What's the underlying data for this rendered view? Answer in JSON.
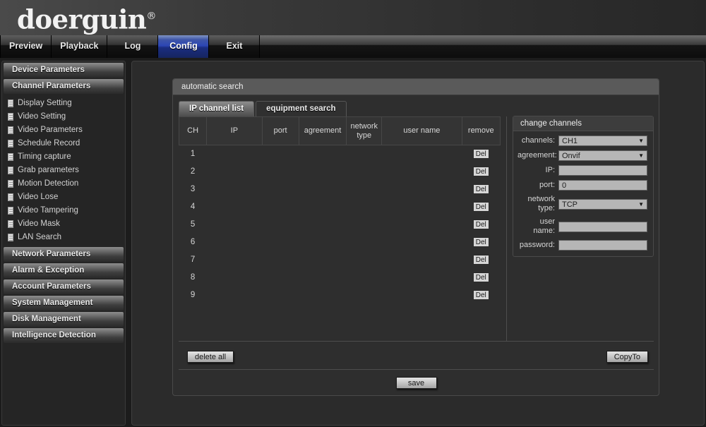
{
  "brand": {
    "name": "doerguin",
    "registered": "®"
  },
  "topnav": {
    "tabs": [
      {
        "label": "Preview",
        "active": false
      },
      {
        "label": "Playback",
        "active": false
      },
      {
        "label": "Log",
        "active": false
      },
      {
        "label": "Config",
        "active": true
      },
      {
        "label": "Exit",
        "active": false
      }
    ],
    "active_color": "#2c46b4"
  },
  "sidebar": {
    "groups": [
      {
        "label": "Device Parameters",
        "items": []
      },
      {
        "label": "Channel Parameters",
        "items": [
          {
            "label": "Display Setting"
          },
          {
            "label": "Video Setting"
          },
          {
            "label": "Video Parameters"
          },
          {
            "label": "Schedule Record"
          },
          {
            "label": "Timing capture"
          },
          {
            "label": "Grab parameters"
          },
          {
            "label": "Motion Detection"
          },
          {
            "label": "Video Lose"
          },
          {
            "label": "Video Tampering"
          },
          {
            "label": "Video Mask"
          },
          {
            "label": "LAN Search"
          }
        ]
      },
      {
        "label": "Network Parameters",
        "items": []
      },
      {
        "label": "Alarm & Exception",
        "items": []
      },
      {
        "label": "Account Parameters",
        "items": []
      },
      {
        "label": "System Management",
        "items": []
      },
      {
        "label": "Disk Management",
        "items": []
      },
      {
        "label": "Intelligence Detection",
        "items": []
      }
    ]
  },
  "panel": {
    "title": "automatic search",
    "tabs": [
      {
        "label": "IP channel list",
        "active": true
      },
      {
        "label": "equipment search",
        "active": false
      }
    ],
    "table": {
      "columns": [
        "CH",
        "IP",
        "port",
        "agreement",
        "network type",
        "user name",
        "remove"
      ],
      "rows": [
        {
          "ch": "1",
          "ip": "",
          "port": "",
          "agreement": "",
          "network_type": "",
          "user_name": "",
          "remove": "Del"
        },
        {
          "ch": "2",
          "ip": "",
          "port": "",
          "agreement": "",
          "network_type": "",
          "user_name": "",
          "remove": "Del"
        },
        {
          "ch": "3",
          "ip": "",
          "port": "",
          "agreement": "",
          "network_type": "",
          "user_name": "",
          "remove": "Del"
        },
        {
          "ch": "4",
          "ip": "",
          "port": "",
          "agreement": "",
          "network_type": "",
          "user_name": "",
          "remove": "Del"
        },
        {
          "ch": "5",
          "ip": "",
          "port": "",
          "agreement": "",
          "network_type": "",
          "user_name": "",
          "remove": "Del"
        },
        {
          "ch": "6",
          "ip": "",
          "port": "",
          "agreement": "",
          "network_type": "",
          "user_name": "",
          "remove": "Del"
        },
        {
          "ch": "7",
          "ip": "",
          "port": "",
          "agreement": "",
          "network_type": "",
          "user_name": "",
          "remove": "Del"
        },
        {
          "ch": "8",
          "ip": "",
          "port": "",
          "agreement": "",
          "network_type": "",
          "user_name": "",
          "remove": "Del"
        },
        {
          "ch": "9",
          "ip": "",
          "port": "",
          "agreement": "",
          "network_type": "",
          "user_name": "",
          "remove": "Del"
        }
      ]
    },
    "change_channels": {
      "title": "change channels",
      "fields": {
        "channels": {
          "label": "channels:",
          "value": "CH1",
          "type": "select"
        },
        "agreement": {
          "label": "agreement:",
          "value": "Onvif",
          "type": "select"
        },
        "ip": {
          "label": "IP:",
          "value": "",
          "type": "text"
        },
        "port": {
          "label": "port:",
          "value": "0",
          "type": "text"
        },
        "network_type": {
          "label": "network type:",
          "value": "TCP",
          "type": "select"
        },
        "user_name": {
          "label": "user name:",
          "value": "",
          "type": "text"
        },
        "password": {
          "label": "password:",
          "value": "",
          "type": "password"
        }
      },
      "copy_to_label": "CopyTo"
    },
    "delete_all_label": "delete all",
    "save_label": "save"
  }
}
